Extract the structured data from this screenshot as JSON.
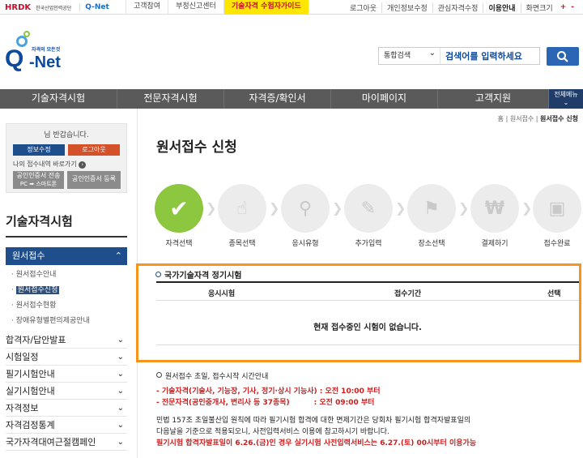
{
  "top": {
    "org_logo": "HRDK",
    "org_sub": "한국산업인력공단",
    "qnet_small": "Q-Net",
    "tabs": [
      "고객참여",
      "부정신고센터",
      "기술자격 수험자가이드"
    ],
    "util": [
      "로그아웃",
      "개인정보수정",
      "관심자격수정",
      "이용안내",
      "화면크기"
    ],
    "zoom_plus": "+",
    "zoom_minus": "-"
  },
  "logo": {
    "slogan": "자격의 모든것",
    "q": "Q",
    "net": "-Net"
  },
  "search": {
    "scope": "통합검색",
    "placeholder": "검색어를 입력하세요"
  },
  "nav": {
    "items": [
      "기술자격시험",
      "전문자격시험",
      "자격증/확인서",
      "마이페이지",
      "고객지원"
    ],
    "all_menu": "전체메뉴"
  },
  "login": {
    "greeting": "님 반갑습니다.",
    "edit_info": "정보수정",
    "logout": "로그아웃",
    "recent_link": "나의 접수내역 바로가기",
    "cert_transfer": "공인인증서 전송",
    "cert_transfer_sub": "PC ➡ 스마트폰",
    "cert_register": "공인인증서 등록"
  },
  "sidebar": {
    "title": "기술자격시험",
    "selected": "원서접수",
    "sub_items": [
      "원서접수안내",
      "원서접수신청",
      "원서접수현황",
      "장애유형별편의제공안내"
    ],
    "menus": [
      "합격자/답안발표",
      "시험일정",
      "필기시험안내",
      "실기시험안내",
      "자격정보",
      "자격검정통계",
      "국가자격대여근절캠페인"
    ]
  },
  "breadcrumb": {
    "home": "홈",
    "sep": " | ",
    "parent": "원서접수",
    "current": "원서접수 신청"
  },
  "page": {
    "title": "원서접수 신청"
  },
  "steps": [
    "자격선택",
    "종목선택",
    "응시유형",
    "추가입력",
    "장소선택",
    "결제하기",
    "접수완료"
  ],
  "table": {
    "section_title": "국가기술자격 정기시험",
    "columns": [
      "응시시험",
      "접수기간",
      "선택"
    ],
    "empty_message": "현재 접수중인 시험이 없습니다."
  },
  "notes": {
    "heading": "원서접수 초일, 접수시작 시간안내",
    "line1": "- 기술자격(기술사, 기능장, 기사, 정기·상시 기능사) : 오전 10:00 부터",
    "line2_a": "- 전문자격(공인중개사, 변리사 등 37종목)",
    "line2_b": ": 오전 09:00 부터",
    "para1": "민법 157조 초일불산입 원칙에 따라 필기시험 합격에 대한 면제기간은 당회차 필기시험 합격자발표일의",
    "para2": "다음날을 기준으로 적용되오니, 사전입력서비스 이용에 참고하시기 바랍니다.",
    "para3": "필기시험 합격자발표일이 6.26.(금)인 경우 실기시험 사전입력서비스는 6.27.(토) 00시부터 이용가능"
  },
  "colors": {
    "brand_blue": "#1f4e8c",
    "step_done": "#8dc63f",
    "highlight": "#f7941d",
    "guide_bg": "#ffe600"
  }
}
